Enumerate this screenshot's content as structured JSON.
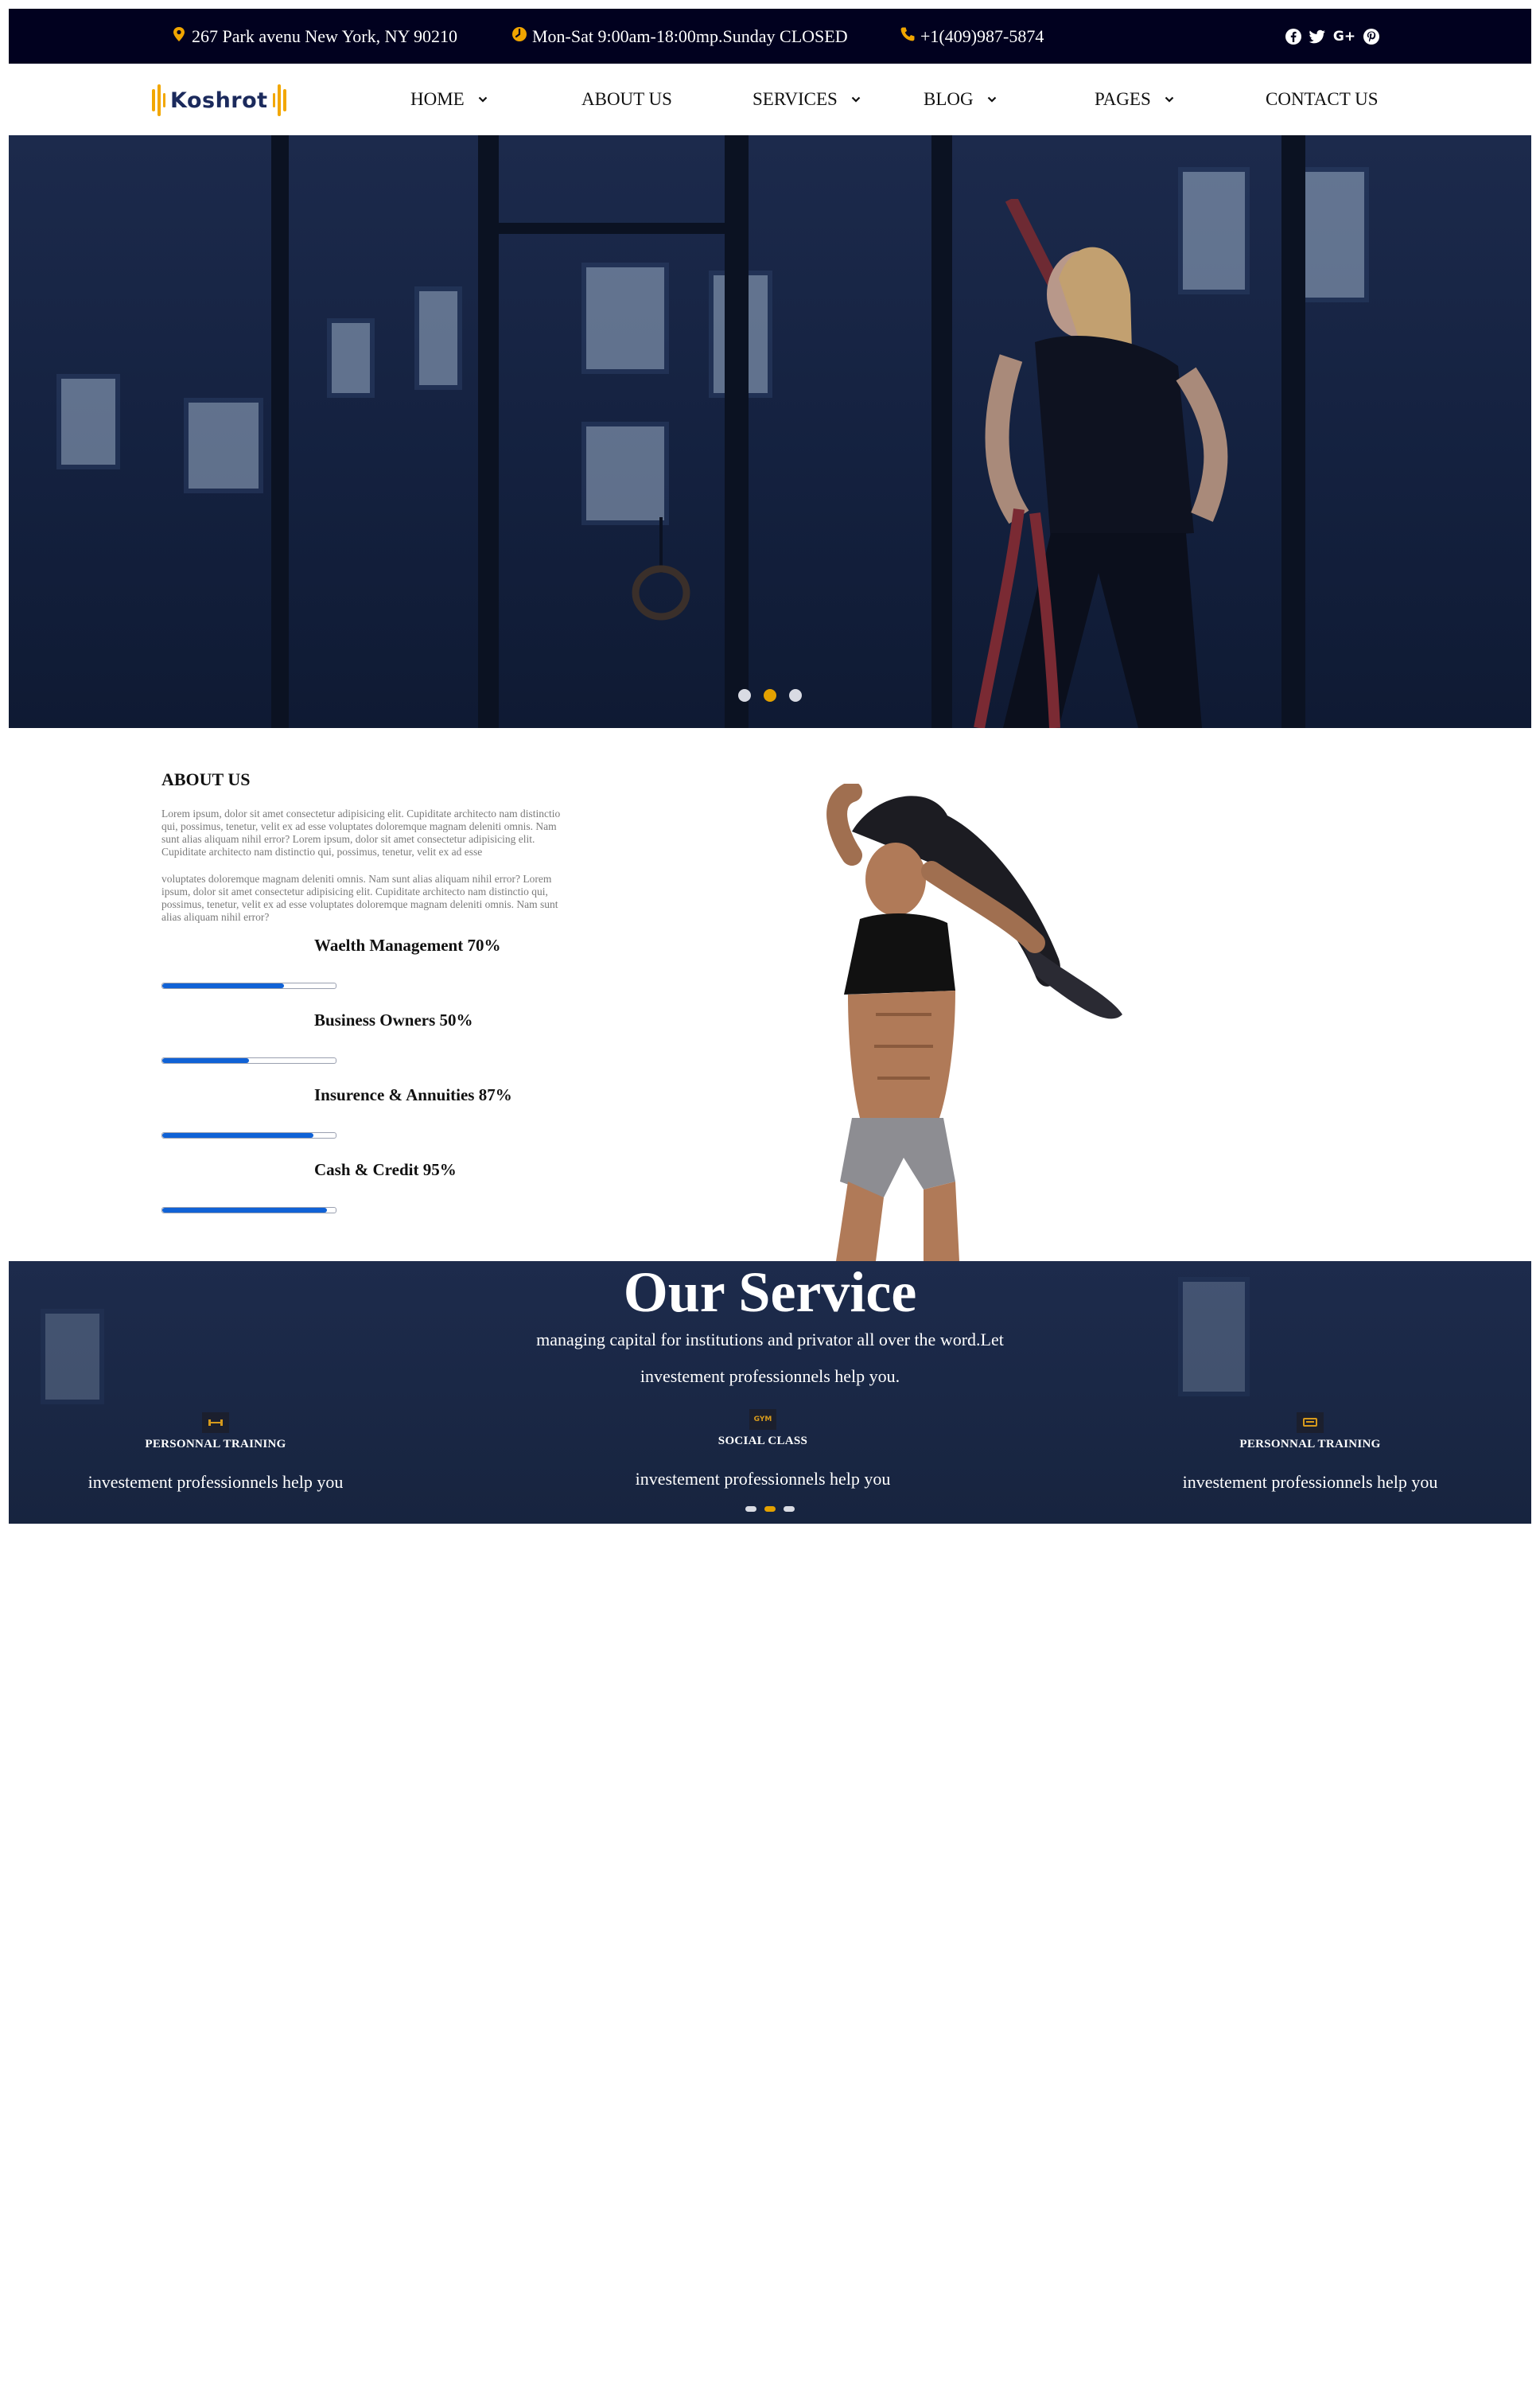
{
  "topbar": {
    "address": "267 Park avenu New York, NY 90210",
    "hours": "Mon-Sat 9:00am-18:00mp.Sunday CLOSED",
    "phone": "+1(409)987-5874",
    "social_icons": [
      "facebook-icon",
      "twitter-icon",
      "google-plus-icon",
      "pinterest-icon"
    ],
    "google_plus_label": "G+",
    "icon_color": "#f0a500"
  },
  "brand": {
    "name": "Koshrot",
    "accent": "#f2a700",
    "text_color": "#1b2a5c"
  },
  "nav": {
    "items": [
      {
        "label": "HOME",
        "dropdown": true
      },
      {
        "label": "ABOUT US",
        "dropdown": false
      },
      {
        "label": "SERVICES",
        "dropdown": true
      },
      {
        "label": "BLOG",
        "dropdown": true
      },
      {
        "label": "PAGES",
        "dropdown": true
      },
      {
        "label": "CONTACT US",
        "dropdown": false
      }
    ]
  },
  "hero": {
    "slides": 3,
    "active_slide": 2
  },
  "about": {
    "title": "ABOUT US",
    "paragraph1": "Lorem ipsum, dolor sit amet consectetur adipisicing elit. Cupiditate architecto nam distinctio qui, possimus, tenetur, velit ex ad esse voluptates doloremque magnam deleniti omnis. Nam sunt alias aliquam nihil error? Lorem ipsum, dolor sit amet consectetur adipisicing elit. Cupiditate architecto nam distinctio qui, possimus, tenetur, velit ex ad esse",
    "paragraph2": "voluptates doloremque magnam deleniti omnis. Nam sunt alias aliquam nihil error? Lorem ipsum, dolor sit amet consectetur adipisicing elit. Cupiditate architecto nam distinctio qui, possimus, tenetur, velit ex ad esse voluptates doloremque magnam deleniti omnis. Nam sunt alias aliquam nihil error?",
    "skills": [
      {
        "label": "Waelth Management 70%",
        "percent": 70
      },
      {
        "label": "Business Owners 50%",
        "percent": 50
      },
      {
        "label": "Insurence & Annuities 87%",
        "percent": 87
      },
      {
        "label": "Cash & Credit 95%",
        "percent": 95
      }
    ],
    "progress_color": "#1062d6"
  },
  "services": {
    "title": "Our Service",
    "subtitle_line1": "managing capital for institutions and privator all over the word.Let",
    "subtitle_line2": "investement professionnels help you.",
    "items": [
      {
        "title": "PERSONNAL TRAINING",
        "desc": "investement professionnels help you",
        "icon": "dumbbell-icon"
      },
      {
        "title": "SOCIAL CLASS",
        "desc": "investement professionnels help you",
        "icon": "gym-badge-icon",
        "icon_text": "GYM"
      },
      {
        "title": "PERSONNAL TRAINING",
        "desc": "investement professionnels help you",
        "icon": "treadmill-icon"
      }
    ],
    "slides": 3,
    "active_slide": 2
  }
}
